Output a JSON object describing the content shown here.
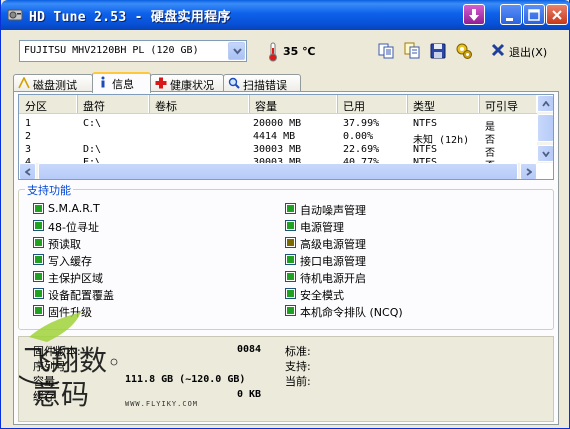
{
  "window": {
    "title": "HD Tune 2.53 - 硬盘实用程序"
  },
  "toolbar": {
    "drive_selected": "FUJITSU MHV2120BH PL (120 GB)",
    "temperature": "35 ℃",
    "exit_label": "退出(X)"
  },
  "tabs": [
    {
      "label": "磁盘测试",
      "icon": "benchmark-icon"
    },
    {
      "label": "信息",
      "icon": "info-icon"
    },
    {
      "label": "健康状况",
      "icon": "health-cross-icon"
    },
    {
      "label": "扫描错误",
      "icon": "magnifier-icon"
    }
  ],
  "partitions": {
    "headers": [
      "分区",
      "盘符",
      "卷标",
      "容量",
      "已用",
      "类型",
      "可引导"
    ],
    "rows": [
      {
        "partition": "1",
        "drive": "C:\\",
        "label": "",
        "capacity": "20000 MB",
        "used": "37.99%",
        "type": "NTFS",
        "bootable": "是"
      },
      {
        "partition": "2",
        "drive": "",
        "label": "",
        "capacity": "4414 MB",
        "used": "0.00%",
        "type": "未知 (12h)",
        "bootable": "否"
      },
      {
        "partition": "3",
        "drive": "D:\\",
        "label": "",
        "capacity": "30003 MB",
        "used": "22.69%",
        "type": "NTFS",
        "bootable": "否"
      },
      {
        "partition": "4",
        "drive": "E:\\",
        "label": "",
        "capacity": "30003 MB",
        "used": "40.77%",
        "type": "NTFS",
        "bootable": "否"
      }
    ]
  },
  "features": {
    "title": "支持功能",
    "left": [
      {
        "label": "S.M.A.R.T",
        "state": "on"
      },
      {
        "label": "48-位寻址",
        "state": "on"
      },
      {
        "label": "预读取",
        "state": "on"
      },
      {
        "label": "写入缓存",
        "state": "on"
      },
      {
        "label": "主保护区域",
        "state": "on"
      },
      {
        "label": "设备配置覆盖",
        "state": "on"
      },
      {
        "label": "固件升级",
        "state": "on"
      }
    ],
    "right": [
      {
        "label": "自动噪声管理",
        "state": "on"
      },
      {
        "label": "电源管理",
        "state": "on"
      },
      {
        "label": "高级电源管理",
        "state": "partial"
      },
      {
        "label": "接口电源管理",
        "state": "on"
      },
      {
        "label": "待机电源开启",
        "state": "on"
      },
      {
        "label": "安全模式",
        "state": "on"
      },
      {
        "label": "本机命令排队 (NCQ)",
        "state": "on"
      }
    ]
  },
  "info": {
    "firmware_label": "固件版本:",
    "firmware_value": "0084",
    "serial_label": "序列号",
    "capacity_label": "容量",
    "capacity_value": "111.8 GB (~120.0 GB)",
    "buffer_label": "缓存",
    "buffer_value": "0 KB",
    "standard_label": "标准:",
    "support_label": "支持:",
    "current_label": "当前:"
  },
  "watermark": {
    "text_top": "飞翔数",
    "text_bottom": "意码",
    "url": "WWW.FLYIKY.COM"
  },
  "colors": {
    "title_bar": "#0751d7",
    "feature_on": "#21a121",
    "group_title": "#0046d5"
  }
}
